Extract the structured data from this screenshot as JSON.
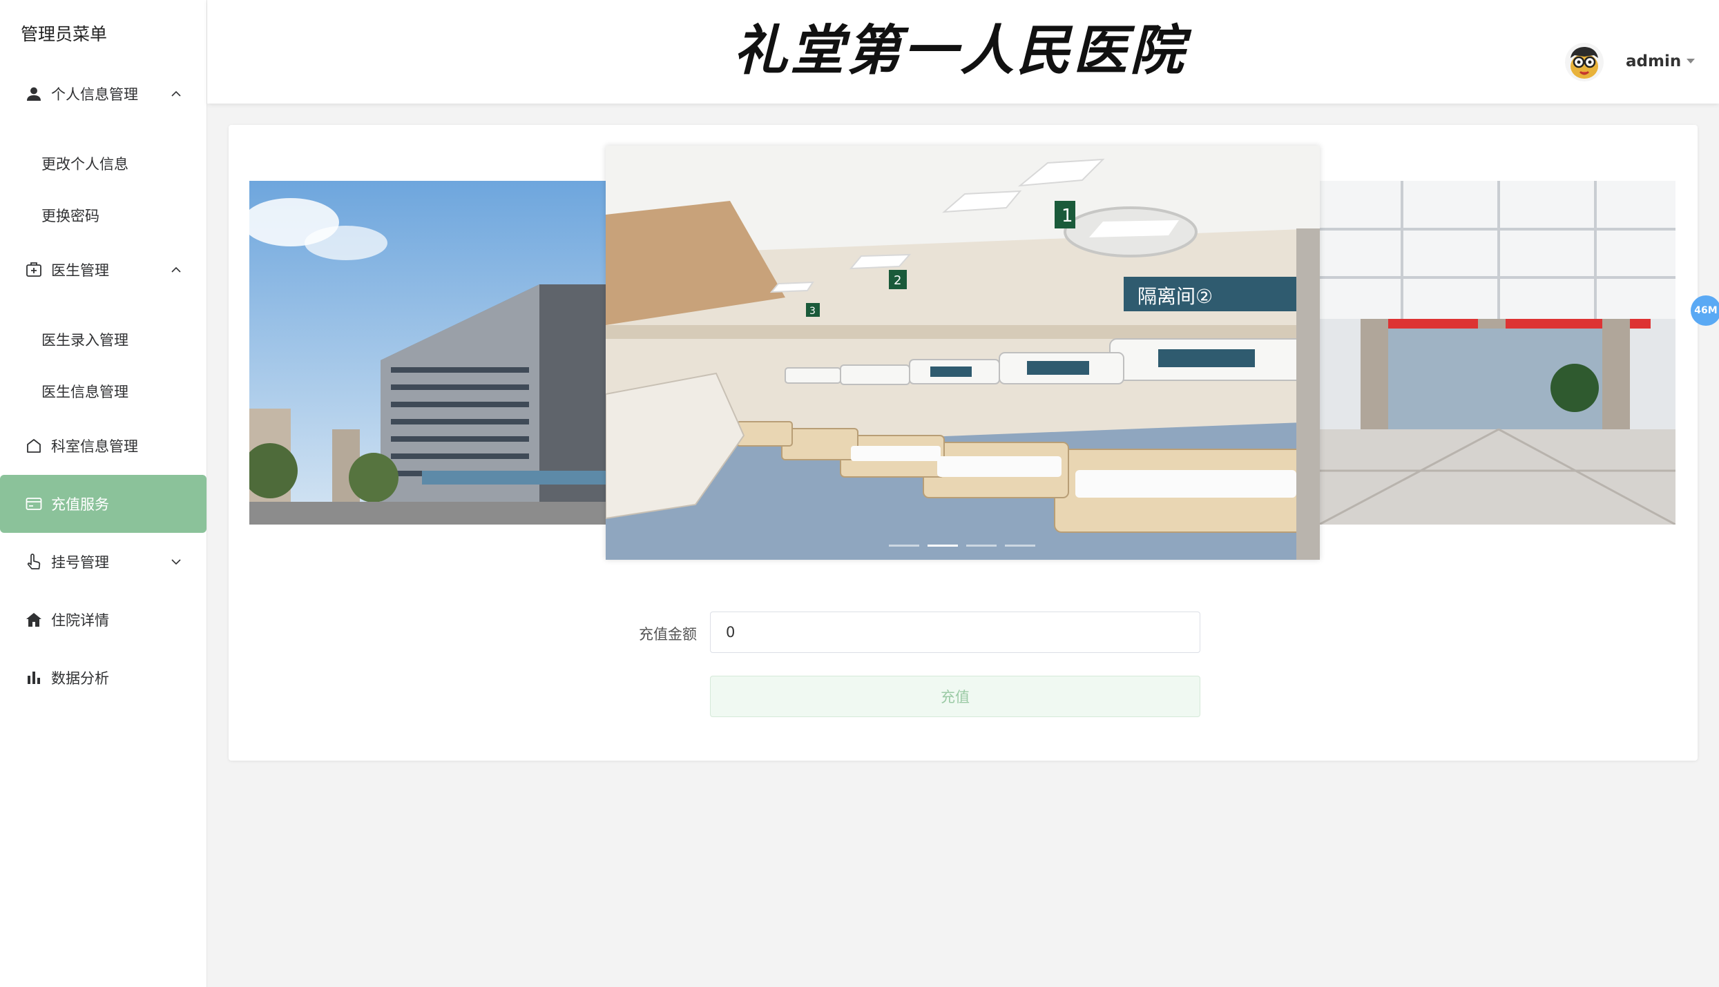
{
  "sidebar": {
    "title": "管理员菜单",
    "items": [
      {
        "label": "个人信息管理",
        "icon": "user-icon",
        "expanded": true
      },
      {
        "label": "更改个人信息"
      },
      {
        "label": "更换密码"
      },
      {
        "label": "医生管理",
        "icon": "medical-kit-icon",
        "expanded": true
      },
      {
        "label": "医生录入管理"
      },
      {
        "label": "医生信息管理"
      },
      {
        "label": "科室信息管理",
        "icon": "house-outline-icon"
      },
      {
        "label": "充值服务",
        "icon": "credit-card-icon",
        "active": true
      },
      {
        "label": "挂号管理",
        "icon": "hand-pointer-icon",
        "expanded": false
      },
      {
        "label": "住院详情",
        "icon": "home-filled-icon"
      },
      {
        "label": "数据分析",
        "icon": "bar-chart-icon"
      }
    ]
  },
  "header": {
    "logo_text": "礼堂第一人民医院",
    "username": "admin"
  },
  "carousel": {
    "slides": [
      "hospital-building-image",
      "hospital-ward-image",
      "hospital-lobby-image"
    ],
    "indicator_count": 4,
    "active_indicator": 1,
    "ward_sign": "隔离间②"
  },
  "form": {
    "amount_label": "充值金额",
    "amount_value": "0",
    "submit_label": "充值"
  },
  "badge": {
    "text": "46M"
  },
  "colors": {
    "accent": "#8bc29a",
    "badge": "#5aa9f4"
  }
}
